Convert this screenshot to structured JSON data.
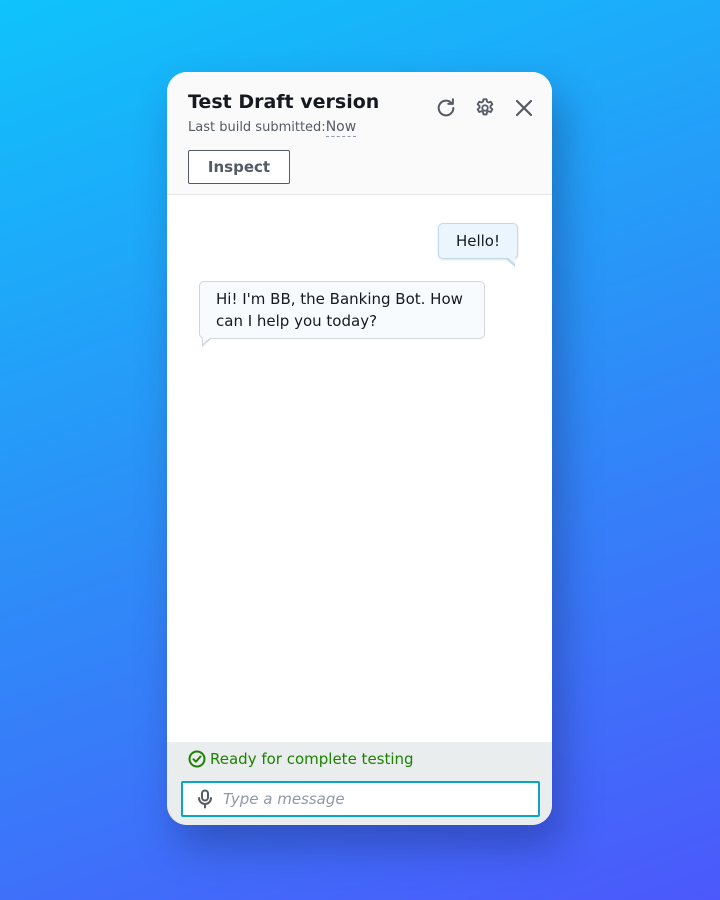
{
  "header": {
    "title": "Test Draft version",
    "subtitle_label": "Last build submitted:",
    "subtitle_value": "Now",
    "inspect_label": "Inspect",
    "icons": [
      "refresh-icon",
      "gear-icon",
      "close-icon"
    ]
  },
  "chat": {
    "messages": [
      {
        "role": "user",
        "text": "Hello!"
      },
      {
        "role": "bot",
        "text": "Hi! I'm BB, the Banking Bot. How can I help you today?"
      }
    ]
  },
  "footer": {
    "status_text": "Ready for complete testing",
    "status_color": "#1d8102",
    "input_placeholder": "Type a message",
    "input_value": ""
  },
  "colors": {
    "input_border": "#0aa6c2",
    "user_bubble": "#eaf5fd",
    "bot_bubble": "#f7fbfe"
  }
}
